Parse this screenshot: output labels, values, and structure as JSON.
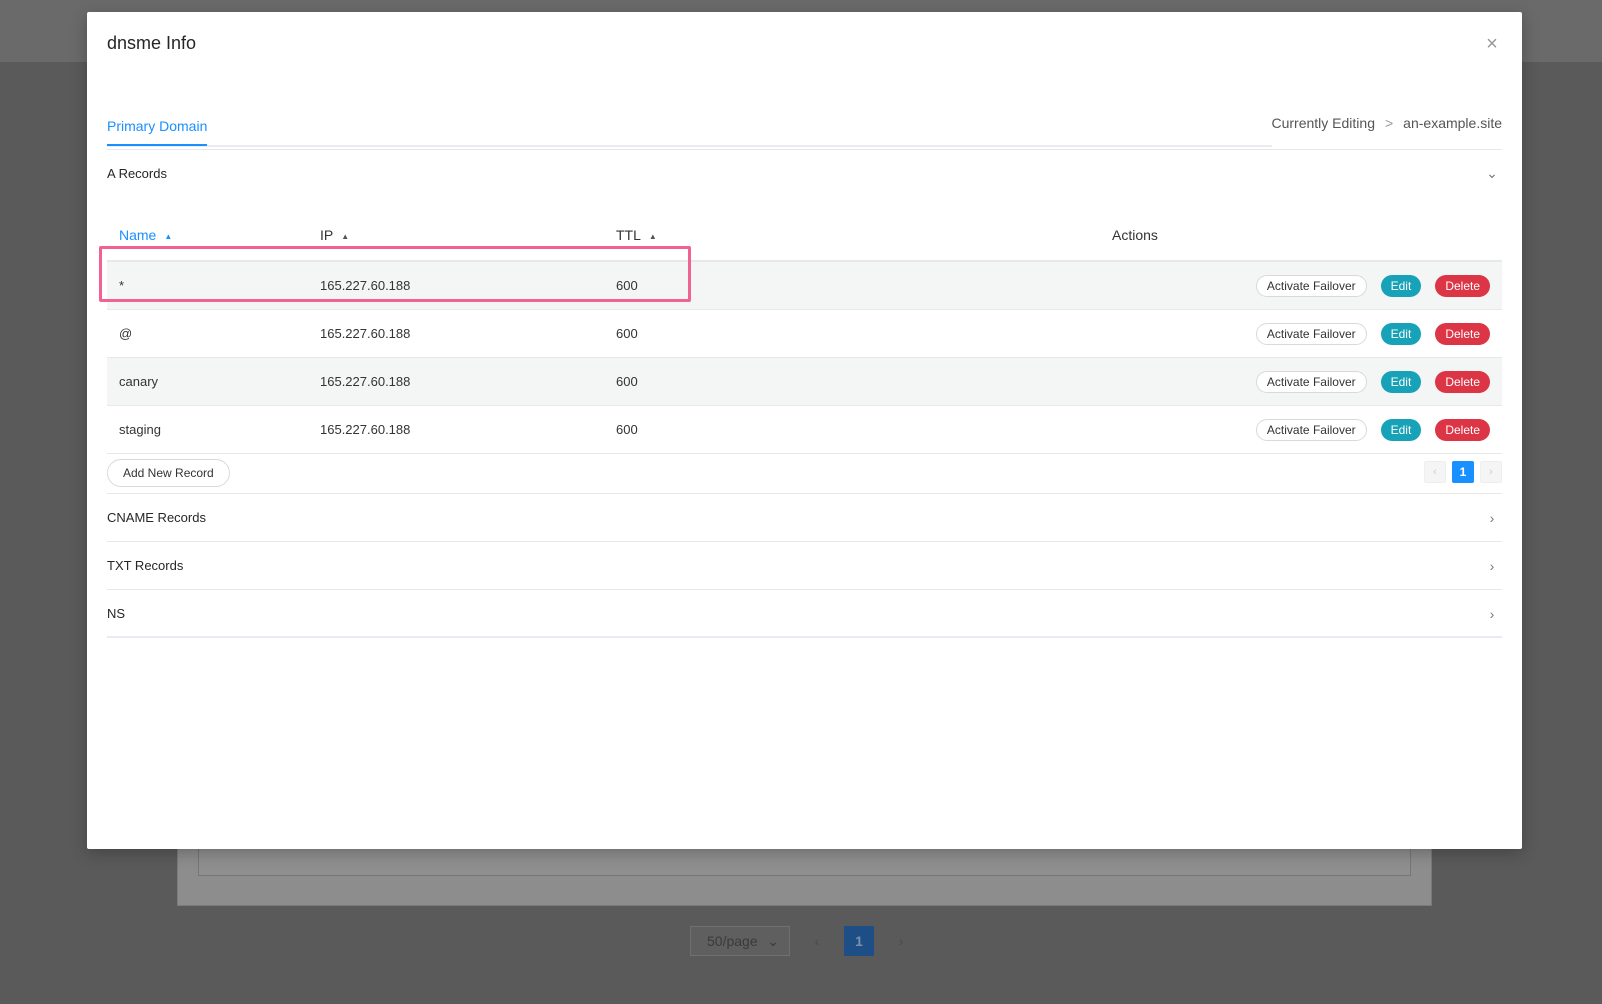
{
  "background": {
    "page_size": "50/page",
    "current_page": "1",
    "prev_icon": "chevron-left",
    "next_icon": "chevron-right",
    "dropdown_icon": "chevron-down"
  },
  "modal": {
    "title": "dnsme Info",
    "close_icon": "×"
  },
  "tabs": [
    {
      "label": "Primary Domain",
      "active": true
    }
  ],
  "editing": {
    "label": "Currently Editing",
    "separator": ">",
    "domain": "an-example.site"
  },
  "a_records": {
    "title": "A Records",
    "chevron": "⌄",
    "columns": {
      "name": "Name",
      "ip": "IP",
      "ttl": "TTL",
      "actions": "Actions"
    },
    "sort_icon": "▲",
    "rows": [
      {
        "name": "*",
        "ip": "165.227.60.188",
        "ttl": "600"
      },
      {
        "name": "@",
        "ip": "165.227.60.188",
        "ttl": "600"
      },
      {
        "name": "canary",
        "ip": "165.227.60.188",
        "ttl": "600"
      },
      {
        "name": "staging",
        "ip": "165.227.60.188",
        "ttl": "600"
      }
    ],
    "buttons": {
      "failover": "Activate Failover",
      "edit": "Edit",
      "delete": "Delete"
    },
    "add_button": "Add New Record",
    "pagination": {
      "prev": "‹",
      "page": "1",
      "next": "›"
    }
  },
  "other_sections": [
    {
      "title": "CNAME Records",
      "chevron": "›"
    },
    {
      "title": "TXT Records",
      "chevron": "›"
    },
    {
      "title": "NS",
      "chevron": "›"
    }
  ],
  "colors": {
    "accent": "#1890ff",
    "edit": "#17a2b8",
    "delete": "#dc3545",
    "highlight": "#f06292"
  }
}
